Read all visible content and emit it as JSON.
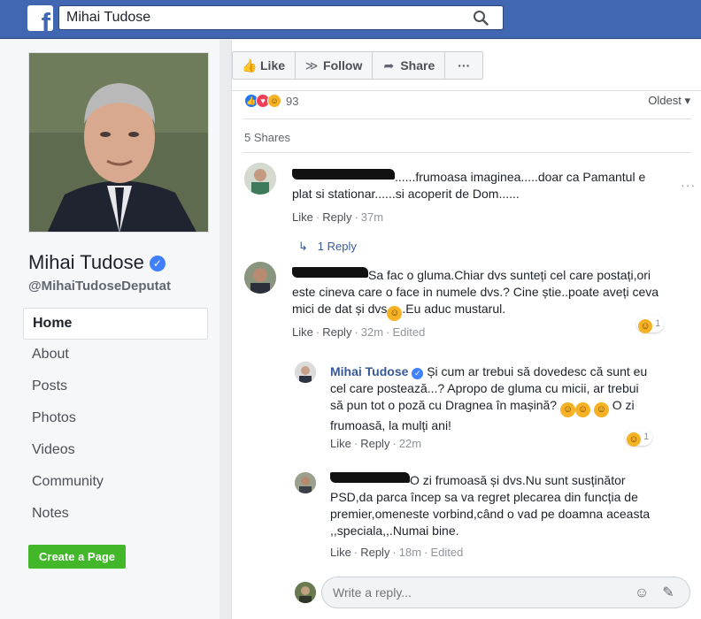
{
  "search": {
    "value": "Mihai Tudose"
  },
  "page": {
    "name": "Mihai Tudose",
    "handle": "@MihaiTudoseDeputat",
    "verified_glyph": "✓"
  },
  "nav": {
    "items": [
      {
        "label": "Home",
        "active": true
      },
      {
        "label": "About"
      },
      {
        "label": "Posts"
      },
      {
        "label": "Photos"
      },
      {
        "label": "Videos"
      },
      {
        "label": "Community"
      },
      {
        "label": "Notes"
      }
    ],
    "create_page": "Create a Page"
  },
  "actions": {
    "like": "Like",
    "follow": "Follow",
    "share": "Share",
    "more": "···"
  },
  "post": {
    "reaction_count": "93",
    "sort_label": "Oldest",
    "shares": "5 Shares"
  },
  "comments": [
    {
      "text": "......frumoasa imaginea.....doar ca Pamantul e plat si stationar......si acoperit de Dom......",
      "like": "Like",
      "reply": "Reply",
      "time": "37m",
      "replies_link": "1 Reply"
    },
    {
      "text_1": "Sa fac o gluma.Chiar dvs sunteți cel care postați,ori este cineva care o face in numele dvs.? Cine știe..poate aveți ceva mici de dat și dvs",
      "text_2": ".Eu aduc mustarul.",
      "like": "Like",
      "reply": "Reply",
      "time": "32m",
      "edited": "Edited",
      "reaction_count": "1"
    },
    {
      "author": "Mihai Tudose",
      "text_1": "Și cum ar trebui să dovedesc că sunt eu cel care postează...? Apropo de gluma cu micii, ar trebui să pun tot o poză cu Dragnea în mașină?",
      "text_2": "O zi frumoasă, la mulți ani!",
      "like": "Like",
      "reply": "Reply",
      "time": "22m",
      "reaction_count": "1"
    },
    {
      "text": "O zi frumoasă și dvs.Nu sunt susținător PSD,da parca încep sa va regret plecarea din funcția de premier,omeneste vorbind,când o vad pe doamna aceasta ,,speciala,,.Numai bine.",
      "like": "Like",
      "reply": "Reply",
      "time": "18m",
      "edited": "Edited"
    }
  ],
  "reply_box": {
    "placeholder": "Write a reply..."
  },
  "colors": {
    "brand": "#4267b2",
    "link": "#385898",
    "green": "#42b72a"
  }
}
